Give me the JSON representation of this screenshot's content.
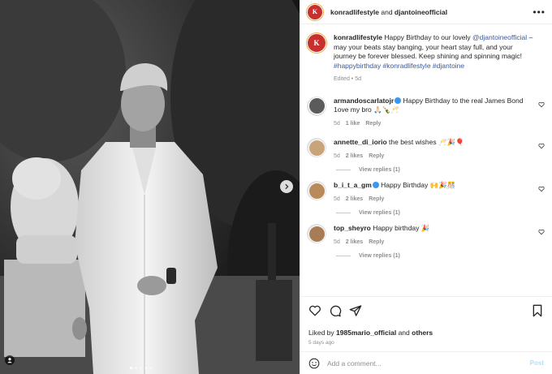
{
  "post": {
    "header": {
      "author": "konradlifestyle",
      "and_text": " and ",
      "collaborator": "djantoineofficial",
      "more_icon": "more-horizontal-icon"
    },
    "caption": {
      "username": "konradlifestyle",
      "text_before": " Happy Birthday to our lovely ",
      "mention": "@djantoineofficial",
      "text_after": " – may your beats stay banging, your heart stay full, and your journey be forever blessed. Keep shining and spinning magic!",
      "hashtags": "#happybirthday #konradlifestyle #djantoine",
      "meta": "Edited • 5d",
      "avatar_letter": "K"
    },
    "comments": [
      {
        "username": "armandoscarlatojr",
        "verified": true,
        "text": " Happy Birthday to the real James Bond 1ove my bro 🙏🏻🍾🥂",
        "age": "5d",
        "likes": "1 like",
        "reply": "Reply",
        "view_replies": ""
      },
      {
        "username": "annette_di_iorio",
        "verified": false,
        "text": " the best wishes 🥂🎉🎈",
        "age": "5d",
        "likes": "2 likes",
        "reply": "Reply",
        "view_replies": "View replies (1)"
      },
      {
        "username": "b_i_t_a_gm",
        "verified": true,
        "text": " Happy Birthday 🙌🎉🎊",
        "age": "5d",
        "likes": "2 likes",
        "reply": "Reply",
        "view_replies": "View replies (1)"
      },
      {
        "username": "top_sheyro",
        "verified": false,
        "text": " Happy birthday 🎉",
        "age": "5d",
        "likes": "2 likes",
        "reply": "Reply",
        "view_replies": "View replies (1)"
      }
    ],
    "liked_by": {
      "prefix": "Liked by ",
      "user": "1985mario_official",
      "and": " and ",
      "others": "others"
    },
    "time_ago": "5 days ago",
    "add_comment": {
      "placeholder": "Add a comment...",
      "post_label": "Post"
    },
    "colors": {
      "link": "#3b5998",
      "brand_red": "#c8302e",
      "muted": "#8e8e8e",
      "verified": "#3897f0",
      "post_disabled": "#b2dffc"
    }
  }
}
